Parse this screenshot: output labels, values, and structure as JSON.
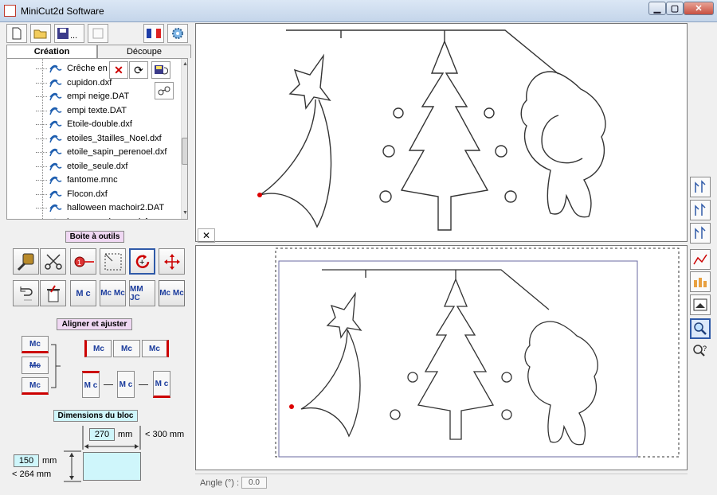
{
  "window": {
    "title": "MiniCut2d Software",
    "min": "▁",
    "max": "▢",
    "close": "✕"
  },
  "tabs": {
    "creation": "Création",
    "decoupe": "Découpe"
  },
  "files": [
    "Crêche en l",
    "cupidon.dxf",
    "empi neige.DAT",
    "empi texte.DAT",
    "Etoile-double.dxf",
    "etoiles_3tailles_Noel.dxf",
    "etoile_sapin_perenoel.dxf",
    "etoile_seule.dxf",
    "fantome.mnc",
    "Flocon.dxf",
    "halloween machoir2.DAT",
    "loup_grand mere.dxf"
  ],
  "sections": {
    "toolbox": "Boite à outils",
    "align": "Aligner et ajuster",
    "dims": "Dimensions du bloc"
  },
  "dims": {
    "width": "270",
    "width_unit": "mm",
    "width_max": "< 300 mm",
    "height": "150",
    "height_unit": "mm",
    "height_max": "< 264 mm"
  },
  "angle": {
    "label": "Angle (°) :",
    "value": "0.0"
  },
  "align_labels": {
    "a1": "Mc",
    "a2": "Mc",
    "a3": "Mc",
    "b1": "Mc",
    "b2": "Mc",
    "b3": "Mc",
    "c1": "M c",
    "c2": "M c",
    "c3": "M c"
  },
  "tool_labels": {
    "text_mc": "M c",
    "mc_stack": "Mc Mc",
    "mc_mirror": "MM JC",
    "mc_grid": "Mc Mc"
  },
  "pane_close": "✕",
  "colors": {
    "accent": "#2f5aa8",
    "label_bg": "#f0d8f3",
    "dim_bg": "#cff6fb"
  }
}
